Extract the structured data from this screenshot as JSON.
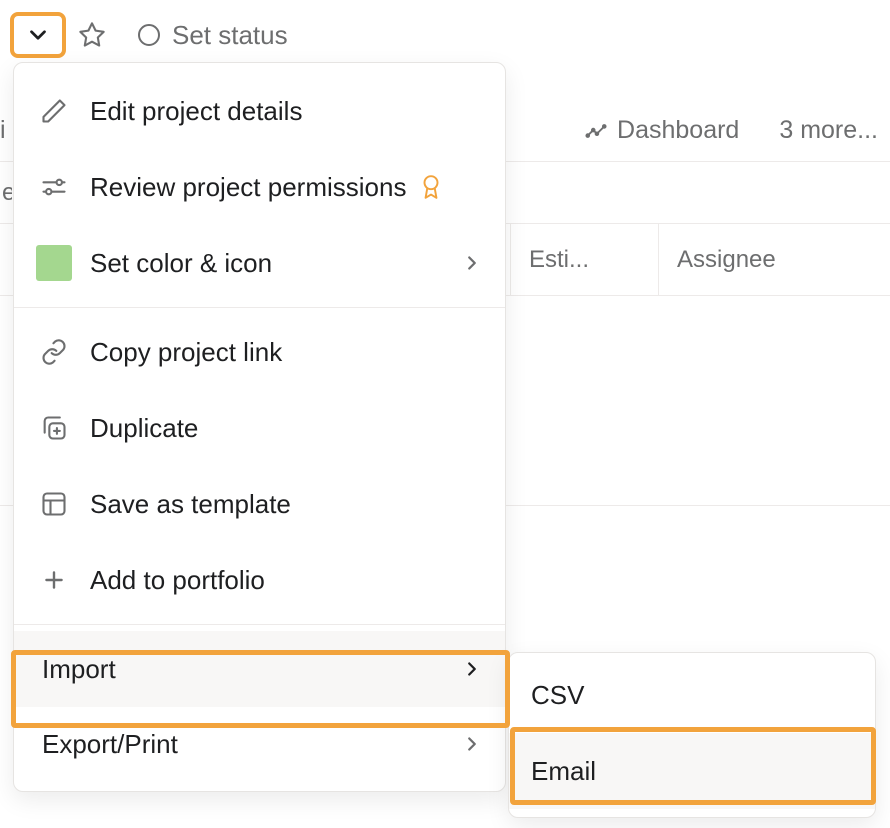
{
  "header": {
    "set_status_label": "Set status"
  },
  "tabs": {
    "dashboard_label": "Dashboard",
    "more_label": "3 more...",
    "partial_left_label": "i",
    "second_row_label": "e"
  },
  "table": {
    "col2": "Esti...",
    "col3": "Assignee"
  },
  "menu": {
    "edit": "Edit project details",
    "permissions": "Review project permissions",
    "color": "Set color & icon",
    "copy_link": "Copy project link",
    "duplicate": "Duplicate",
    "save_template": "Save as template",
    "add_portfolio": "Add to portfolio",
    "import": "Import",
    "export": "Export/Print"
  },
  "submenu": {
    "csv": "CSV",
    "email": "Email"
  }
}
